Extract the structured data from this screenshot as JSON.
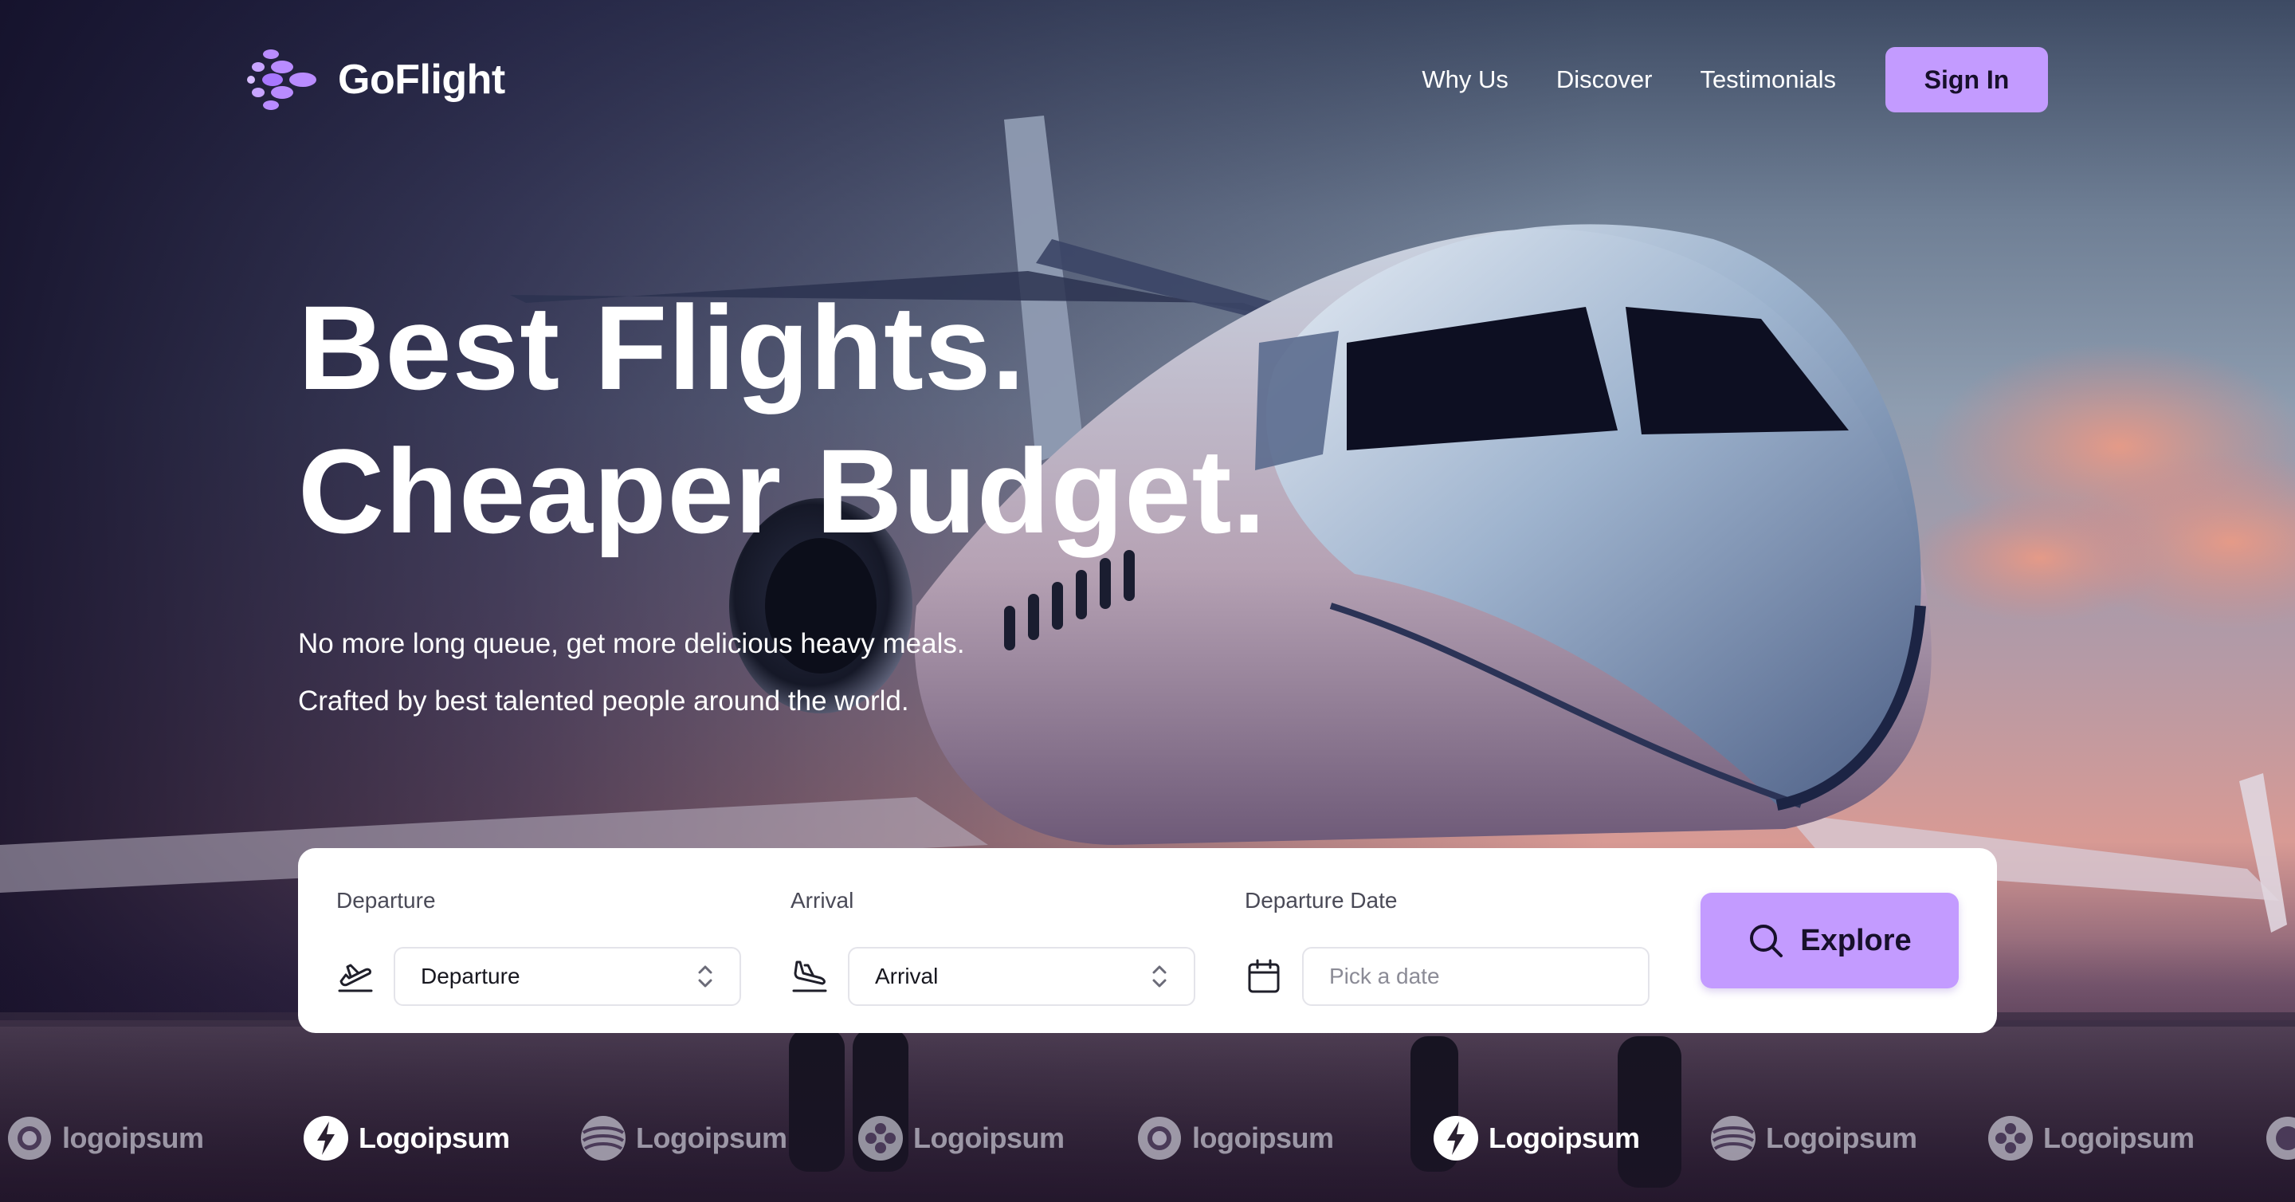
{
  "brand": {
    "name": "GoFlight",
    "logo_icon": "dots-cluster-icon",
    "accent": "#c39bff"
  },
  "nav": {
    "links": [
      "Why Us",
      "Discover",
      "Testimonials"
    ],
    "signin_label": "Sign In"
  },
  "hero": {
    "headline_line1": "Best Flights.",
    "headline_line2": "Cheaper Budget.",
    "sub_line1": "No more long queue, get more delicious heavy meals.",
    "sub_line2": "Crafted by best talented people around the world."
  },
  "search": {
    "departure": {
      "label": "Departure",
      "value": "Departure",
      "icon": "plane-takeoff-icon"
    },
    "arrival": {
      "label": "Arrival",
      "value": "Arrival",
      "icon": "plane-landing-icon"
    },
    "date": {
      "label": "Departure Date",
      "placeholder": "Pick a date",
      "icon": "calendar-icon"
    },
    "explore_label": "Explore"
  },
  "partners": [
    {
      "name": "logoipsum",
      "icon": "ring-logo-icon",
      "style": "faded"
    },
    {
      "name": "Logoipsum",
      "icon": "bolt-logo-icon",
      "style": "solid"
    },
    {
      "name": "Logoipsum",
      "icon": "waves-logo-icon",
      "style": "faded"
    },
    {
      "name": "Logoipsum",
      "icon": "petals-logo-icon",
      "style": "faded"
    },
    {
      "name": "logoipsum",
      "icon": "ring-logo-icon",
      "style": "faded"
    },
    {
      "name": "Logoipsum",
      "icon": "bolt-logo-icon",
      "style": "solid"
    },
    {
      "name": "Logoipsum",
      "icon": "waves-logo-icon",
      "style": "faded"
    },
    {
      "name": "Logoipsum",
      "icon": "petals-logo-icon",
      "style": "faded"
    }
  ]
}
